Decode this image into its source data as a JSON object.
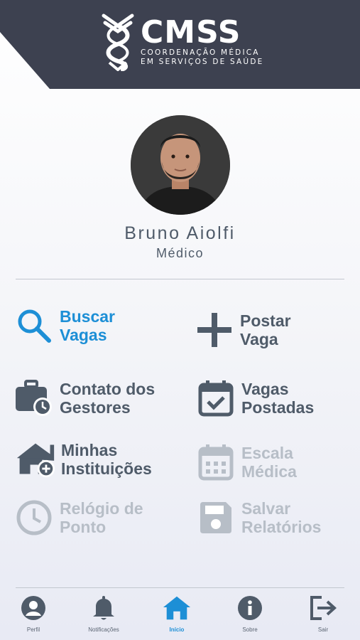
{
  "header": {
    "brand": "CMSS",
    "subtitle_line1": "COORDENAÇÃO MÉDICA",
    "subtitle_line2": "EM SERVIÇOS DE SAÚDE",
    "colors": {
      "background": "#3d4150",
      "text": "#ffffff"
    }
  },
  "profile": {
    "name": "Bruno Aiolfi",
    "role": "Médico"
  },
  "menu": [
    {
      "label": "Buscar Vagas",
      "icon": "search-icon",
      "state": "active"
    },
    {
      "label": "Postar Vaga",
      "icon": "plus-icon",
      "state": "normal"
    },
    {
      "label": "Contato dos Gestores",
      "icon": "briefcase-clock-icon",
      "state": "normal"
    },
    {
      "label": "Vagas Postadas",
      "icon": "calendar-check-icon",
      "state": "normal"
    },
    {
      "label": "Minhas Instituições",
      "icon": "house-add-icon",
      "state": "normal"
    },
    {
      "label": "Escala Médica",
      "icon": "calendar-grid-icon",
      "state": "disabled"
    },
    {
      "label": "Relógio de Ponto",
      "icon": "clock-icon",
      "state": "disabled"
    },
    {
      "label": "Salvar Relatórios",
      "icon": "floppy-disk-icon",
      "state": "disabled"
    }
  ],
  "tabs": [
    {
      "label": "Perfil",
      "icon": "user-circle-icon"
    },
    {
      "label": "Notificações",
      "icon": "bell-icon"
    },
    {
      "label": "Início",
      "icon": "home-icon",
      "selected": true
    },
    {
      "label": "Sobre",
      "icon": "info-icon"
    },
    {
      "label": "Sair",
      "icon": "logout-icon"
    }
  ],
  "colors": {
    "accent": "#1d8fd6",
    "text": "#4f5b69",
    "disabled": "#b7bec7"
  }
}
